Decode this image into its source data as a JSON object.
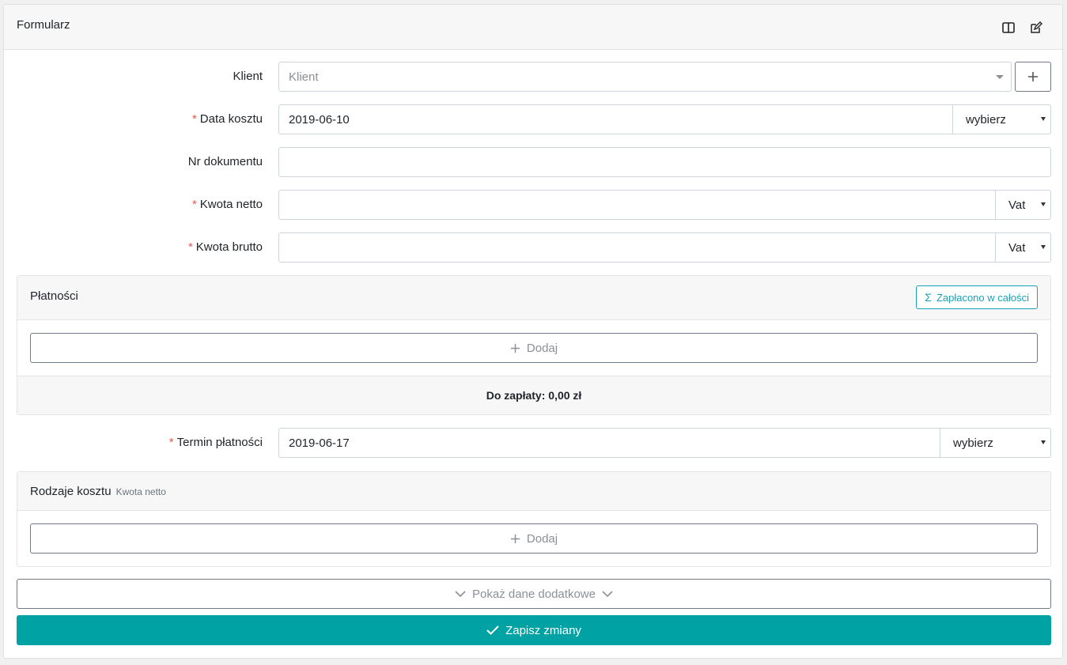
{
  "card": {
    "title": "Formularz"
  },
  "fields": {
    "klient": {
      "label": "Klient",
      "placeholder": "Klient"
    },
    "data_kosztu": {
      "label": "Data kosztu",
      "value": "2019-06-10",
      "select": "wybierz"
    },
    "nr_dokumentu": {
      "label": "Nr dokumentu",
      "value": ""
    },
    "kwota_netto": {
      "label": "Kwota netto",
      "value": "",
      "select": "Vat"
    },
    "kwota_brutto": {
      "label": "Kwota brutto",
      "value": "",
      "select": "Vat"
    },
    "termin_platnosci": {
      "label": "Termin płatności",
      "value": "2019-06-17",
      "select": "wybierz"
    }
  },
  "required_mark": "*",
  "platnosci": {
    "title": "Płatności",
    "paid_button": "Zapłacono w całości",
    "add_label": "Dodaj",
    "due_label": "Do zapłaty: 0,00 zł"
  },
  "rodzaje": {
    "title": "Rodzaje kosztu",
    "subtitle": "Kwota netto",
    "add_label": "Dodaj"
  },
  "more_button": "Pokaż dane dodatkowe",
  "save_button": "Zapisz zmiany",
  "colors": {
    "accent": "#00a2a4",
    "info": "#17a2b8",
    "required": "#e05a4f"
  },
  "icons": [
    "columns-icon",
    "edit-icon",
    "plus-icon",
    "sigma-icon",
    "chevron-down-icon",
    "check-icon"
  ]
}
